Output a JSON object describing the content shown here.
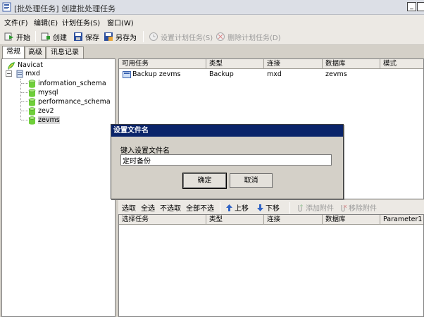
{
  "window": {
    "title": "[批处理任务] 创建批处理任务",
    "minimize_glyph": "_"
  },
  "menu": [
    "文件(F)",
    "编辑(E)",
    "计划任务(S)",
    "窗口(W)"
  ],
  "toolbar": {
    "start": "开始",
    "create": "创建",
    "save": "保存",
    "save_as": "另存为",
    "set_scheduled": "设置计划任务(S)",
    "delete_scheduled": "删除计划任务(D)"
  },
  "tabs": [
    "常规",
    "高级",
    "讯息记录"
  ],
  "tree": {
    "root": "Navicat",
    "connection": "mxd",
    "databases": [
      "information_schema",
      "mysql",
      "performance_schema",
      "zev2",
      "zevms"
    ],
    "selected": "zevms"
  },
  "available_tasks": {
    "columns": [
      "可用任务",
      "类型",
      "连接",
      "数据库",
      "模式"
    ],
    "rows": [
      {
        "task": "Backup zevms",
        "type": "Backup",
        "connection": "mxd",
        "database": "zevms",
        "mode": ""
      }
    ]
  },
  "selection_toolbar": {
    "select": "选取",
    "select_all": "全选",
    "deselect": "不选取",
    "deselect_all": "全部不选",
    "move_up": "上移",
    "move_down": "下移",
    "add_attachment": "添加附件",
    "remove_attachment": "移除附件"
  },
  "selected_tasks": {
    "columns": [
      "选择任务",
      "类型",
      "连接",
      "数据库",
      "Parameter1"
    ]
  },
  "dialog": {
    "title": "设置文件名",
    "prompt": "键入设置文件名",
    "value": "定时备份",
    "ok": "确定",
    "cancel": "取消"
  },
  "colors": {
    "dialog_title_bg": "#0a246a",
    "db_icon": "#6fcf3a",
    "window_bg": "#d4d0c8"
  }
}
